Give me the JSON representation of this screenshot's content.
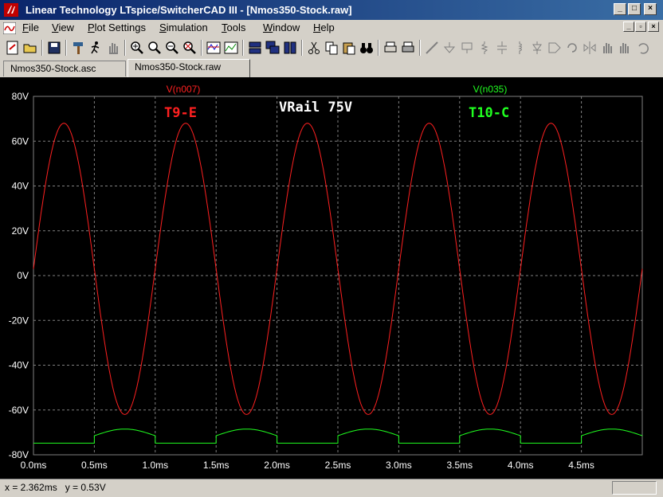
{
  "window": {
    "title": "Linear Technology LTspice/SwitcherCAD III - [Nmos350-Stock.raw]"
  },
  "menu": [
    {
      "label": "File",
      "u": "F"
    },
    {
      "label": "View",
      "u": "V"
    },
    {
      "label": "Plot Settings",
      "u": "P"
    },
    {
      "label": "Simulation",
      "u": "S"
    },
    {
      "label": "Tools",
      "u": "T"
    },
    {
      "label": "Window",
      "u": "W"
    },
    {
      "label": "Help",
      "u": "H"
    }
  ],
  "tabs": [
    {
      "label": "Nmos350-Stock.asc",
      "active": false
    },
    {
      "label": "Nmos350-Stock.raw",
      "active": true
    }
  ],
  "plot": {
    "trace_labels": [
      {
        "text": "V(n007)",
        "color": "#ff2020"
      },
      {
        "text": "V(n035)",
        "color": "#20ff20"
      }
    ],
    "annotations": [
      {
        "text": "T9-E",
        "color": "#ff2020"
      },
      {
        "text": "VRail 75V",
        "color": "#ffffff"
      },
      {
        "text": "T10-C",
        "color": "#20ff20"
      }
    ]
  },
  "chart_data": {
    "type": "line",
    "xlabel": "",
    "ylabel": "",
    "xlim": [
      0,
      5.0
    ],
    "ylim": [
      -80,
      80
    ],
    "x_unit": "ms",
    "y_unit": "V",
    "x_ticks": [
      "0.0ms",
      "0.5ms",
      "1.0ms",
      "1.5ms",
      "2.0ms",
      "2.5ms",
      "3.0ms",
      "3.5ms",
      "4.0ms",
      "4.5ms"
    ],
    "x_tick_values": [
      0,
      0.5,
      1.0,
      1.5,
      2.0,
      2.5,
      3.0,
      3.5,
      4.0,
      4.5
    ],
    "y_ticks": [
      "80V",
      "60V",
      "40V",
      "20V",
      "0V",
      "-20V",
      "-40V",
      "-60V",
      "-80V"
    ],
    "y_tick_values": [
      80,
      60,
      40,
      20,
      0,
      -20,
      -40,
      -60,
      -80
    ],
    "grid": true,
    "series": [
      {
        "name": "V(n007)",
        "color": "#ff2020",
        "description_points": {
          "period_ms": 1.0,
          "peak": 68,
          "trough": -62,
          "offset": 3
        },
        "x": [
          0,
          0.25,
          0.5,
          0.75,
          1.0,
          1.25,
          1.5,
          1.75,
          2.0,
          2.25,
          2.5,
          2.75,
          3.0,
          3.25,
          3.5,
          3.75,
          4.0,
          4.25,
          4.5,
          4.75,
          5.0
        ],
        "y": [
          3,
          68,
          3,
          -62,
          3,
          68,
          3,
          -62,
          3,
          68,
          3,
          -62,
          3,
          68,
          3,
          -62,
          3,
          68,
          3,
          -62,
          3
        ]
      },
      {
        "name": "V(n035)",
        "color": "#20ff20",
        "x": [
          0,
          0.5,
          0.5,
          0.75,
          1.0,
          1.0,
          1.5,
          1.5,
          1.75,
          2.0,
          2.0,
          2.5,
          2.5,
          2.75,
          3.0,
          3.0,
          3.5,
          3.5,
          3.75,
          4.0,
          4.0,
          4.5,
          4.5,
          4.75,
          5.0
        ],
        "y": [
          -74.8,
          -74.8,
          -71.5,
          -68.5,
          -71.5,
          -74.8,
          -74.8,
          -71.5,
          -68.5,
          -71.5,
          -74.8,
          -74.8,
          -71.5,
          -68.5,
          -71.5,
          -74.8,
          -74.8,
          -71.5,
          -68.5,
          -71.5,
          -74.8,
          -74.8,
          -71.5,
          -68.5,
          -70.5
        ]
      }
    ]
  },
  "status": {
    "cursor_readout": "x = 2.362ms   y = 0.53V"
  }
}
